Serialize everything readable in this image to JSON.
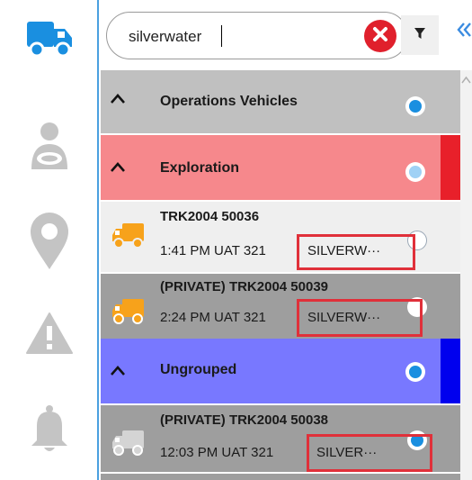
{
  "search": {
    "value": "silverwater"
  },
  "colors": {
    "nav_active": "#1a8fe0",
    "nav_inactive": "#c4c4c4",
    "clear_button": "#e0202c",
    "group_operations_bg": "#c0c0c0",
    "group_exploration_bg": "#f6888c",
    "group_exploration_accent": "#e8202a",
    "group_ungrouped_bg": "#7878ff",
    "group_ungrouped_accent": "#0000ee",
    "vehicle_light_bg": "#efefef",
    "vehicle_dark_bg": "#9e9e9e",
    "truck_orange": "#f7a21b",
    "truck_gray": "#d4d4d4",
    "highlight_box": "#e0303a",
    "radio_dot": "#1a8fe0"
  },
  "nav": {
    "items": [
      {
        "icon": "truck-icon",
        "active": true
      },
      {
        "icon": "driver-icon",
        "active": false
      },
      {
        "icon": "location-pin-icon",
        "active": false
      },
      {
        "icon": "warning-icon",
        "active": false
      },
      {
        "icon": "bell-icon",
        "active": false
      }
    ]
  },
  "groups": [
    {
      "name": "Operations Vehicles",
      "selected": true
    },
    {
      "name": "Exploration",
      "selected": false
    },
    {
      "name": "Ungrouped",
      "selected": true
    }
  ],
  "vehicles": [
    {
      "name": "TRK2004 50036",
      "time": "1:41 PM UAT 321",
      "location": "SILVERW···",
      "selected": false
    },
    {
      "name": "(PRIVATE) TRK2004 50039",
      "time": "2:24 PM UAT 321",
      "location": "SILVERW···",
      "selected": false
    },
    {
      "name": "(PRIVATE) TRK2004 50038",
      "time": "12:03 PM UAT 321",
      "location": "SILVER···",
      "selected": true
    }
  ]
}
